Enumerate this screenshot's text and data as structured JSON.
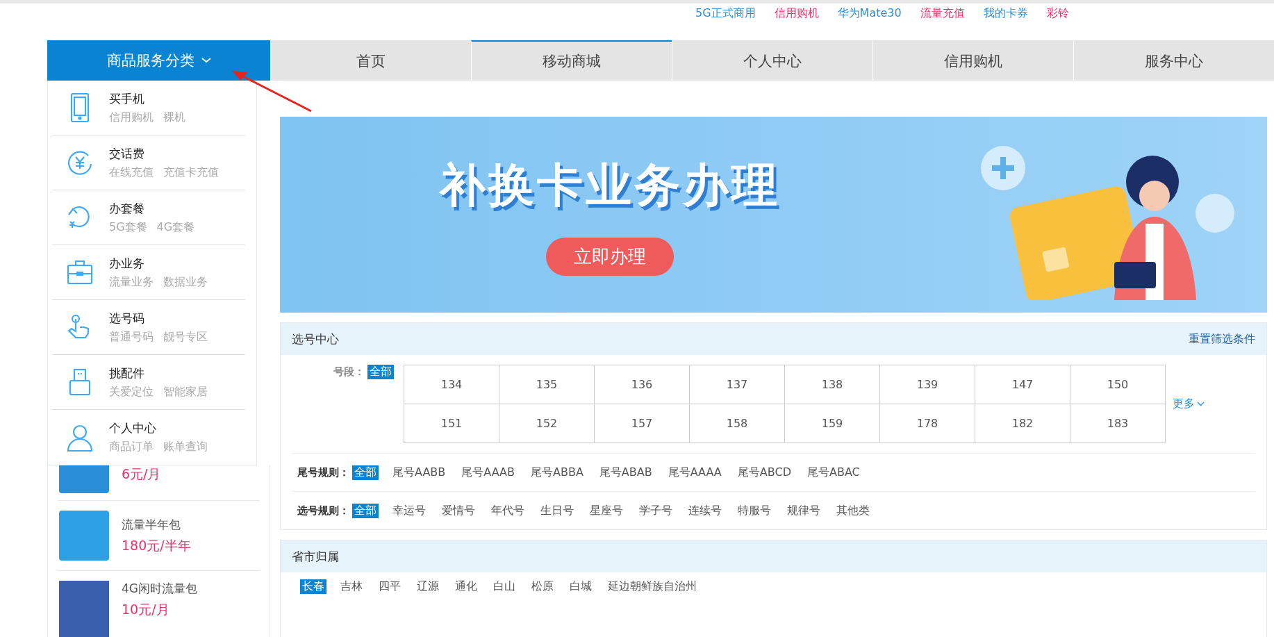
{
  "top_links": [
    {
      "label": "5G正式商用",
      "color": "#2b8fd6"
    },
    {
      "label": "信用购机",
      "color": "#e8336a"
    },
    {
      "label": "华为Mate30",
      "color": "#2b8fd6"
    },
    {
      "label": "流量充值",
      "color": "#e8336a"
    },
    {
      "label": "我的卡券",
      "color": "#2b8fd6"
    },
    {
      "label": "彩铃",
      "color": "#e8336a"
    }
  ],
  "category_menu": {
    "label": "商品服务分类",
    "expanded": true,
    "items": [
      {
        "kind": "phone",
        "title": "买手机",
        "links": [
          "信用购机",
          "裸机"
        ]
      },
      {
        "kind": "yuan",
        "title": "交话费",
        "links": [
          "在线充值",
          "充值卡充值"
        ]
      },
      {
        "kind": "cycle",
        "title": "办套餐",
        "links": [
          "5G套餐",
          "4G套餐"
        ]
      },
      {
        "kind": "briefcase",
        "title": "办业务",
        "links": [
          "流量业务",
          "数据业务"
        ]
      },
      {
        "kind": "hand",
        "title": "选号码",
        "links": [
          "普通号码",
          "靓号专区"
        ]
      },
      {
        "kind": "usb",
        "title": "挑配件",
        "links": [
          "关爱定位",
          "智能家居"
        ]
      },
      {
        "kind": "person",
        "title": "个人中心",
        "links": [
          "商品订单",
          "账单查询"
        ]
      }
    ]
  },
  "nav_tabs": [
    {
      "label": "首页",
      "selected": false
    },
    {
      "label": "移动商城",
      "selected": true
    },
    {
      "label": "个人中心",
      "selected": false
    },
    {
      "label": "信用购机",
      "selected": false
    },
    {
      "label": "服务中心",
      "selected": false
    }
  ],
  "products": [
    {
      "price": "6元/月"
    },
    {
      "name": "流量半年包",
      "price": "180元/半年"
    },
    {
      "name": "4G闲时流量包",
      "price": "10元/月"
    }
  ],
  "banner": {
    "title": "补换卡业务办理",
    "button": "立即办理"
  },
  "number_center": {
    "title": "选号中心",
    "reset": "重置筛选条件",
    "segment_label": "号段：",
    "segment_all": {
      "label": "全部",
      "selected": true
    },
    "segments": [
      "134",
      "135",
      "136",
      "137",
      "138",
      "139",
      "147",
      "150",
      "151",
      "152",
      "157",
      "158",
      "159",
      "178",
      "182",
      "183"
    ],
    "more": "更多",
    "rules": [
      {
        "label": "尾号规则：",
        "options": [
          {
            "label": "全部",
            "selected": true
          },
          {
            "label": "尾号AABB",
            "selected": false
          },
          {
            "label": "尾号AAAB",
            "selected": false
          },
          {
            "label": "尾号ABBA",
            "selected": false
          },
          {
            "label": "尾号ABAB",
            "selected": false
          },
          {
            "label": "尾号AAAA",
            "selected": false
          },
          {
            "label": "尾号ABCD",
            "selected": false
          },
          {
            "label": "尾号ABAC",
            "selected": false
          }
        ]
      },
      {
        "label": "选号规则：",
        "options": [
          {
            "label": "全部",
            "selected": true
          },
          {
            "label": "幸运号",
            "selected": false
          },
          {
            "label": "爱情号",
            "selected": false
          },
          {
            "label": "年代号",
            "selected": false
          },
          {
            "label": "生日号",
            "selected": false
          },
          {
            "label": "星座号",
            "selected": false
          },
          {
            "label": "学子号",
            "selected": false
          },
          {
            "label": "连续号",
            "selected": false
          },
          {
            "label": "特服号",
            "selected": false
          },
          {
            "label": "规律号",
            "selected": false
          },
          {
            "label": "其他类",
            "selected": false
          }
        ]
      }
    ]
  },
  "region": {
    "title": "省市归属",
    "cities": [
      {
        "label": "长春",
        "selected": true
      },
      {
        "label": "吉林",
        "selected": false
      },
      {
        "label": "四平",
        "selected": false
      },
      {
        "label": "辽源",
        "selected": false
      },
      {
        "label": "通化",
        "selected": false
      },
      {
        "label": "白山",
        "selected": false
      },
      {
        "label": "松原",
        "selected": false
      },
      {
        "label": "白城",
        "selected": false
      },
      {
        "label": "延边朝鲜族自治州",
        "selected": false
      }
    ]
  }
}
